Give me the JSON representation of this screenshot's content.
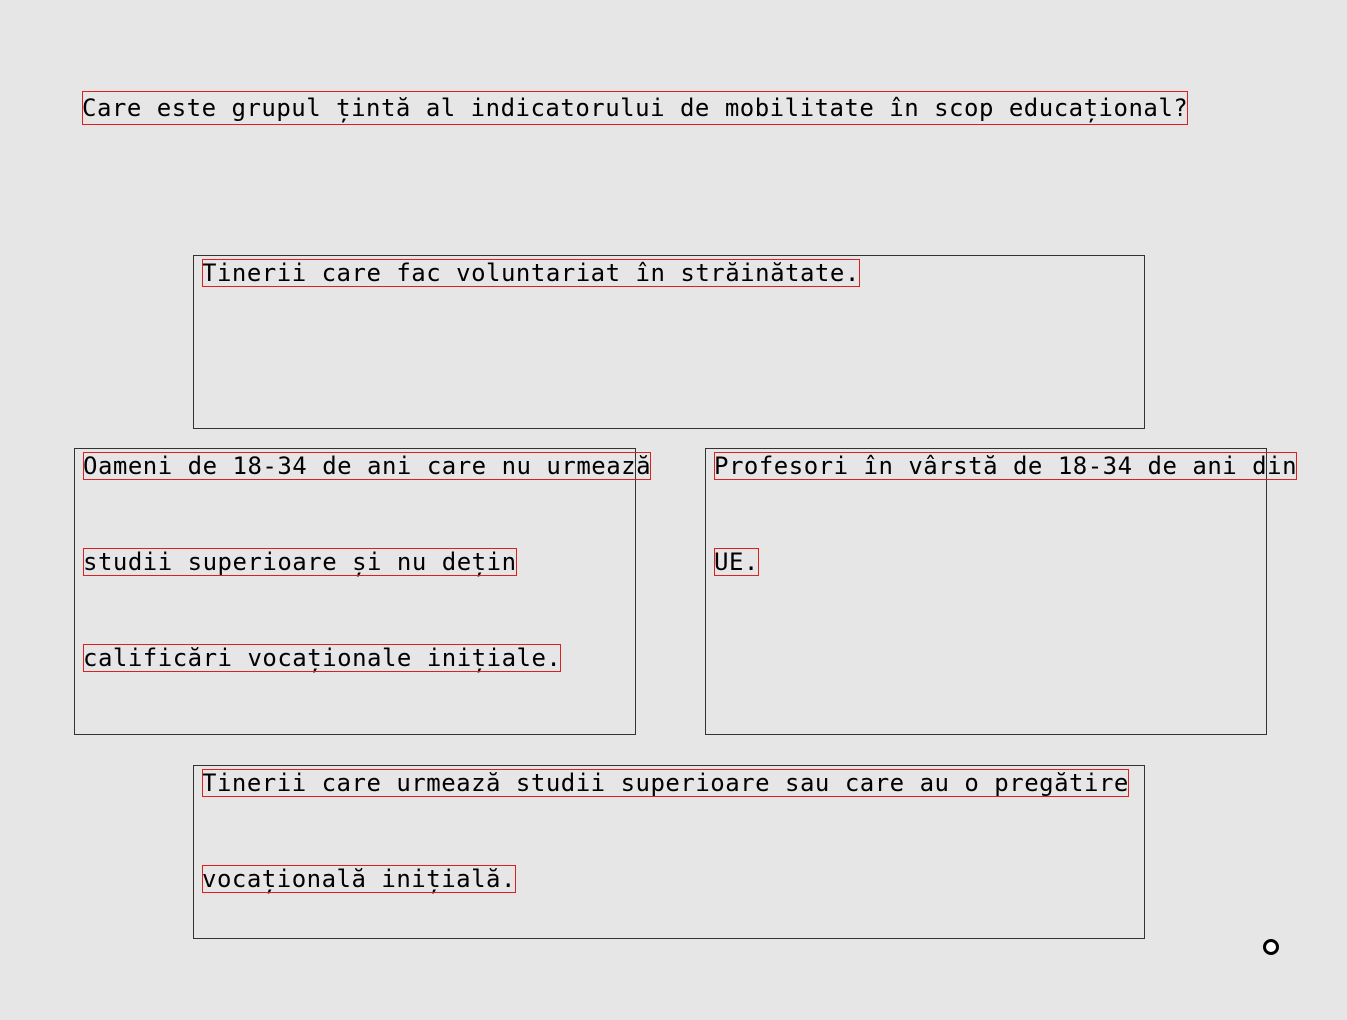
{
  "question": "Care este grupul țintă al indicatorului de mobilitate în scop educațional?",
  "answers": [
    {
      "lines": [
        "Tinerii care fac voluntariat în străinătate."
      ]
    },
    {
      "lines": [
        "Oameni de 18-34 de ani care nu urmează",
        "studii superioare și nu dețin",
        "calificări vocaționale inițiale."
      ]
    },
    {
      "lines": [
        "Profesori în vârstă de 18-34 de ani din",
        "UE."
      ]
    },
    {
      "lines": [
        "Tinerii care urmează studii superioare sau care au o pregătire",
        "vocațională inițială."
      ]
    }
  ]
}
